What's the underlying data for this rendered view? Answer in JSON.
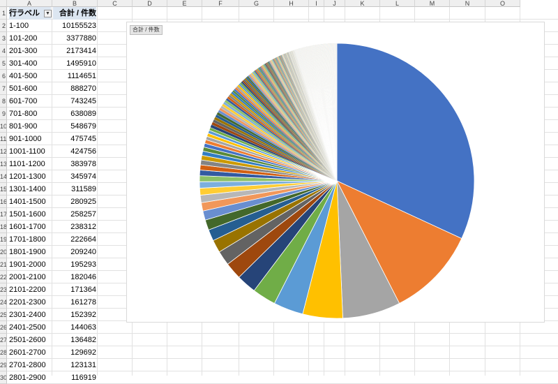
{
  "sheet": {
    "columns": [
      "A",
      "B",
      "C",
      "D",
      "E",
      "F",
      "G",
      "H",
      "I",
      "J",
      "K",
      "L",
      "M",
      "N",
      "O"
    ],
    "row_numbers": [
      "1",
      "2",
      "3",
      "4",
      "5",
      "6",
      "7",
      "8",
      "9",
      "10",
      "11",
      "12",
      "13",
      "14",
      "15",
      "16",
      "17",
      "18",
      "19",
      "20",
      "21",
      "22",
      "23",
      "24",
      "25",
      "26",
      "27",
      "28",
      "29",
      "30"
    ],
    "pivot": {
      "header_label": "行ラベル",
      "header_value": "合計 / 件数",
      "rows": [
        {
          "label": "1-100",
          "value": "10155523"
        },
        {
          "label": "101-200",
          "value": "3377880"
        },
        {
          "label": "201-300",
          "value": "2173414"
        },
        {
          "label": "301-400",
          "value": "1495910"
        },
        {
          "label": "401-500",
          "value": "1114651"
        },
        {
          "label": "501-600",
          "value": "888270"
        },
        {
          "label": "601-700",
          "value": "743245"
        },
        {
          "label": "701-800",
          "value": "638089"
        },
        {
          "label": "801-900",
          "value": "548679"
        },
        {
          "label": "901-1000",
          "value": "475745"
        },
        {
          "label": "1001-1100",
          "value": "424756"
        },
        {
          "label": "1101-1200",
          "value": "383978"
        },
        {
          "label": "1201-1300",
          "value": "345974"
        },
        {
          "label": "1301-1400",
          "value": "311589"
        },
        {
          "label": "1401-1500",
          "value": "280925"
        },
        {
          "label": "1501-1600",
          "value": "258257"
        },
        {
          "label": "1601-1700",
          "value": "238312"
        },
        {
          "label": "1701-1800",
          "value": "222664"
        },
        {
          "label": "1801-1900",
          "value": "209240"
        },
        {
          "label": "1901-2000",
          "value": "195293"
        },
        {
          "label": "2001-2100",
          "value": "182046"
        },
        {
          "label": "2101-2200",
          "value": "171364"
        },
        {
          "label": "2201-2300",
          "value": "161278"
        },
        {
          "label": "2301-2400",
          "value": "152392"
        },
        {
          "label": "2401-2500",
          "value": "144063"
        },
        {
          "label": "2501-2600",
          "value": "136482"
        },
        {
          "label": "2601-2700",
          "value": "129692"
        },
        {
          "label": "2701-2800",
          "value": "123131"
        },
        {
          "label": "2801-2900",
          "value": "116919"
        }
      ]
    }
  },
  "chart": {
    "field_button_label": "合計 / 件数"
  },
  "chart_data": {
    "type": "pie",
    "categories": [
      "1-100",
      "101-200",
      "201-300",
      "301-400",
      "401-500",
      "501-600",
      "601-700",
      "701-800",
      "801-900",
      "901-1000",
      "1001-1100",
      "1101-1200",
      "1201-1300",
      "1301-1400",
      "1401-1500",
      "1501-1600",
      "1601-1700",
      "1701-1800",
      "1801-1900",
      "1901-2000",
      "2001-2100",
      "2101-2200",
      "2201-2300",
      "2301-2400",
      "2401-2500",
      "2501-2600",
      "2601-2700",
      "2701-2800",
      "2801-2900"
    ],
    "values": [
      10155523,
      3377880,
      2173414,
      1495910,
      1114651,
      888270,
      743245,
      638089,
      548679,
      475745,
      424756,
      383978,
      345974,
      311589,
      280925,
      258257,
      238312,
      222664,
      209240,
      195293,
      182046,
      171364,
      161278,
      152392,
      144063,
      136482,
      129692,
      123131,
      116919
    ],
    "remaining_share_of_total_estimate": 0.19,
    "colors": [
      "#4472C4",
      "#ED7D31",
      "#A5A5A5",
      "#FFC000",
      "#5B9BD5",
      "#70AD47",
      "#264478",
      "#9E480E",
      "#636363",
      "#997300",
      "#255E91",
      "#43682B",
      "#698ED0",
      "#F1975A",
      "#B7B7B7",
      "#FFCD33",
      "#7CAFDD",
      "#8CC168",
      "#335AA1",
      "#D26012",
      "#848484",
      "#CC9A00",
      "#327DC2",
      "#5A8A39"
    ]
  }
}
